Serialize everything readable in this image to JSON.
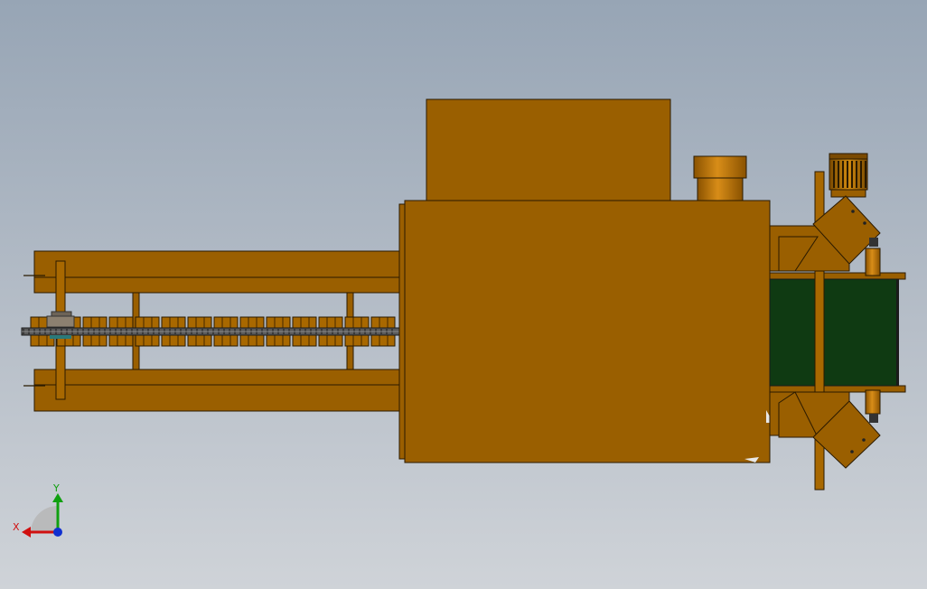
{
  "colors": {
    "background_top": "#97a5b5",
    "background_bottom": "#cfd3d8",
    "body": "#9a5f00",
    "body_light": "#b87400",
    "edge": "#2a1a00",
    "belt": "#0f3a12",
    "chain": "#3a3a3a",
    "axis_x": "#d01010",
    "axis_y": "#10a010",
    "axis_z": "#1030d0"
  },
  "triad": {
    "x_label": "X",
    "y_label": "Y"
  }
}
